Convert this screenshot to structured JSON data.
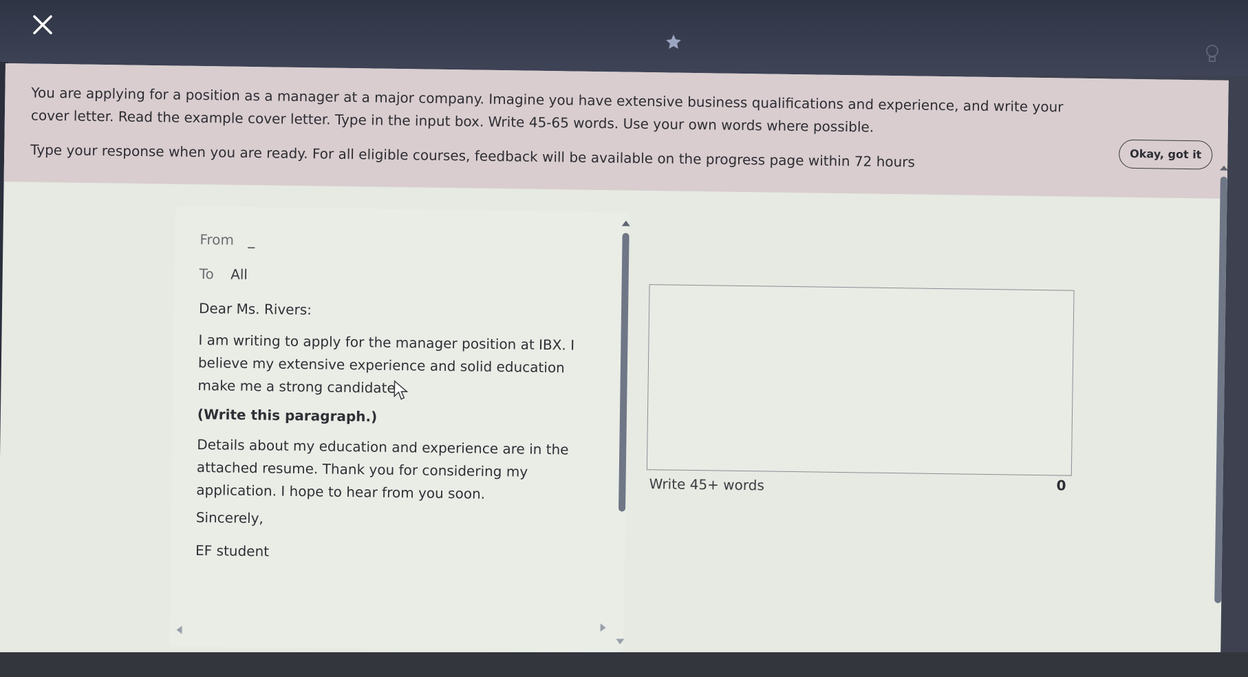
{
  "header": {
    "close_icon": "close-icon",
    "star_icon": "star-icon",
    "bulb_icon": "lightbulb-icon"
  },
  "banner": {
    "instructions": "You are applying for a position as a manager at a major company. Imagine you have extensive business qualifications and experience, and write your cover letter. Read the example cover letter. Type in the input box. Write 45-65 words. Use your own words where possible.",
    "note": "Type your response when you are ready. For all eligible courses, feedback will be available on the progress page within 72 hours",
    "ok_button": "Okay, got it"
  },
  "letter": {
    "from_label": "From",
    "from_value": "_",
    "to_label": "To",
    "to_value": "All",
    "greeting": "Dear Ms. Rivers:",
    "para1": "I am writing to apply for the manager position at IBX. I believe my extensive experience and solid education make me a strong candidate.",
    "para2": "(Write this paragraph.)",
    "para3": "Details about my education and experience are in the attached resume. Thank you for considering my application. I hope to hear from you soon.",
    "closing": "Sincerely,",
    "signature": "EF student"
  },
  "answer": {
    "value": "",
    "hint": "Write 45+ words",
    "word_count": "0"
  },
  "side": {
    "edge_number": "25"
  },
  "colors": {
    "banner_bg": "#d9cdcf",
    "page_bg": "#e6eae2",
    "topbar_bg": "#2f3445"
  }
}
